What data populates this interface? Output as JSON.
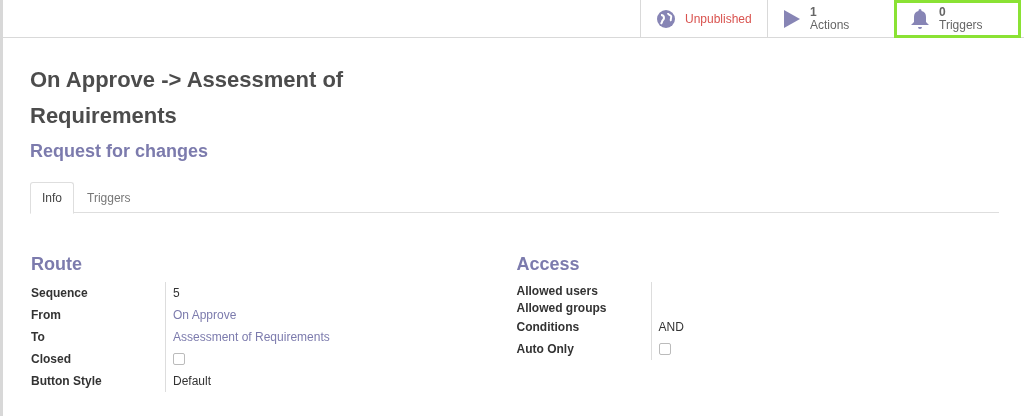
{
  "stat_buttons": [
    {
      "kind": "publish",
      "label": "Unpublished",
      "highlighted": false
    },
    {
      "kind": "actions",
      "count": "1",
      "label": "Actions",
      "highlighted": false
    },
    {
      "kind": "triggers",
      "count": "0",
      "label": "Triggers",
      "highlighted": true
    }
  ],
  "title": "On Approve -> Assessment of Requirements",
  "subtitle": "Request for changes",
  "tabs": [
    {
      "label": "Info",
      "selected": true
    },
    {
      "label": "Triggers",
      "selected": false
    }
  ],
  "groups": [
    {
      "title": "Route",
      "fields": [
        {
          "kind": "text",
          "label": "Sequence",
          "value": "5"
        },
        {
          "kind": "link",
          "label": "From",
          "value": "On Approve"
        },
        {
          "kind": "link",
          "label": "To",
          "value": "Assessment of Requirements"
        },
        {
          "kind": "checkbox",
          "label": "Closed",
          "checked": false
        },
        {
          "kind": "text",
          "label": "Button Style",
          "value": "Default"
        }
      ]
    },
    {
      "title": "Access",
      "fields": [
        {
          "kind": "empty",
          "label": "Allowed users"
        },
        {
          "kind": "empty",
          "label": "Allowed groups"
        },
        {
          "kind": "text",
          "label": "Conditions",
          "value": "AND"
        },
        {
          "kind": "checkbox",
          "label": "Auto Only",
          "checked": false
        }
      ]
    }
  ]
}
